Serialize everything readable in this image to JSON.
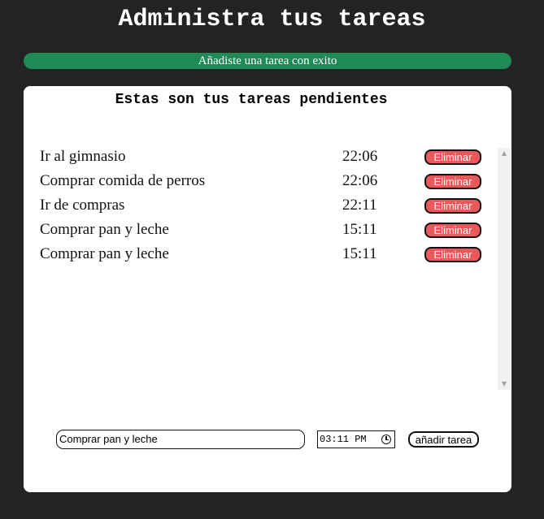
{
  "header": {
    "title": "Administra tus tareas"
  },
  "alert": {
    "message": "Añadiste una tarea con exito",
    "color": "#1e8a55"
  },
  "card": {
    "title": "Estas son tus tareas pendientes",
    "tasks": [
      {
        "name": "Ir al gimnasio",
        "time": "22:06",
        "action": "Eliminar"
      },
      {
        "name": "Comprar comida de perros",
        "time": "22:06",
        "action": "Eliminar"
      },
      {
        "name": "Ir de compras",
        "time": "22:11",
        "action": "Eliminar"
      },
      {
        "name": "Comprar pan y leche",
        "time": "15:11",
        "action": "Eliminar"
      },
      {
        "name": "Comprar pan y leche",
        "time": "15:11",
        "action": "Eliminar"
      }
    ]
  },
  "form": {
    "task_value": "Comprar pan y leche",
    "time_value": "03:11 PM",
    "add_label": "añadir tarea"
  },
  "icons": {
    "clock": "clock-icon",
    "scroll_up": "scroll-up-arrow",
    "scroll_down": "scroll-down-arrow"
  },
  "colors": {
    "background": "#232323",
    "delete_button": "#e8595b",
    "card": "#ffffff"
  }
}
